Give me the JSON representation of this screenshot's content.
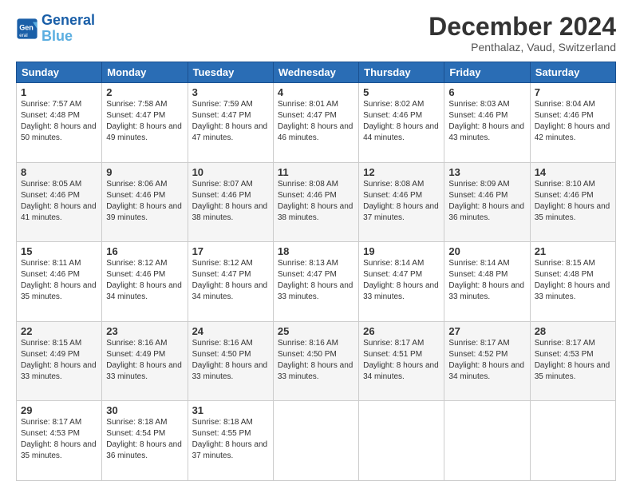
{
  "logo": {
    "line1": "General",
    "line2": "Blue"
  },
  "title": "December 2024",
  "subtitle": "Penthalaz, Vaud, Switzerland",
  "days": [
    "Sunday",
    "Monday",
    "Tuesday",
    "Wednesday",
    "Thursday",
    "Friday",
    "Saturday"
  ],
  "weeks": [
    [
      {
        "day": "1",
        "sunrise": "7:57 AM",
        "sunset": "4:48 PM",
        "daylight": "8 hours and 50 minutes."
      },
      {
        "day": "2",
        "sunrise": "7:58 AM",
        "sunset": "4:47 PM",
        "daylight": "8 hours and 49 minutes."
      },
      {
        "day": "3",
        "sunrise": "7:59 AM",
        "sunset": "4:47 PM",
        "daylight": "8 hours and 47 minutes."
      },
      {
        "day": "4",
        "sunrise": "8:01 AM",
        "sunset": "4:47 PM",
        "daylight": "8 hours and 46 minutes."
      },
      {
        "day": "5",
        "sunrise": "8:02 AM",
        "sunset": "4:46 PM",
        "daylight": "8 hours and 44 minutes."
      },
      {
        "day": "6",
        "sunrise": "8:03 AM",
        "sunset": "4:46 PM",
        "daylight": "8 hours and 43 minutes."
      },
      {
        "day": "7",
        "sunrise": "8:04 AM",
        "sunset": "4:46 PM",
        "daylight": "8 hours and 42 minutes."
      }
    ],
    [
      {
        "day": "8",
        "sunrise": "8:05 AM",
        "sunset": "4:46 PM",
        "daylight": "8 hours and 41 minutes."
      },
      {
        "day": "9",
        "sunrise": "8:06 AM",
        "sunset": "4:46 PM",
        "daylight": "8 hours and 39 minutes."
      },
      {
        "day": "10",
        "sunrise": "8:07 AM",
        "sunset": "4:46 PM",
        "daylight": "8 hours and 38 minutes."
      },
      {
        "day": "11",
        "sunrise": "8:08 AM",
        "sunset": "4:46 PM",
        "daylight": "8 hours and 38 minutes."
      },
      {
        "day": "12",
        "sunrise": "8:08 AM",
        "sunset": "4:46 PM",
        "daylight": "8 hours and 37 minutes."
      },
      {
        "day": "13",
        "sunrise": "8:09 AM",
        "sunset": "4:46 PM",
        "daylight": "8 hours and 36 minutes."
      },
      {
        "day": "14",
        "sunrise": "8:10 AM",
        "sunset": "4:46 PM",
        "daylight": "8 hours and 35 minutes."
      }
    ],
    [
      {
        "day": "15",
        "sunrise": "8:11 AM",
        "sunset": "4:46 PM",
        "daylight": "8 hours and 35 minutes."
      },
      {
        "day": "16",
        "sunrise": "8:12 AM",
        "sunset": "4:46 PM",
        "daylight": "8 hours and 34 minutes."
      },
      {
        "day": "17",
        "sunrise": "8:12 AM",
        "sunset": "4:47 PM",
        "daylight": "8 hours and 34 minutes."
      },
      {
        "day": "18",
        "sunrise": "8:13 AM",
        "sunset": "4:47 PM",
        "daylight": "8 hours and 33 minutes."
      },
      {
        "day": "19",
        "sunrise": "8:14 AM",
        "sunset": "4:47 PM",
        "daylight": "8 hours and 33 minutes."
      },
      {
        "day": "20",
        "sunrise": "8:14 AM",
        "sunset": "4:48 PM",
        "daylight": "8 hours and 33 minutes."
      },
      {
        "day": "21",
        "sunrise": "8:15 AM",
        "sunset": "4:48 PM",
        "daylight": "8 hours and 33 minutes."
      }
    ],
    [
      {
        "day": "22",
        "sunrise": "8:15 AM",
        "sunset": "4:49 PM",
        "daylight": "8 hours and 33 minutes."
      },
      {
        "day": "23",
        "sunrise": "8:16 AM",
        "sunset": "4:49 PM",
        "daylight": "8 hours and 33 minutes."
      },
      {
        "day": "24",
        "sunrise": "8:16 AM",
        "sunset": "4:50 PM",
        "daylight": "8 hours and 33 minutes."
      },
      {
        "day": "25",
        "sunrise": "8:16 AM",
        "sunset": "4:50 PM",
        "daylight": "8 hours and 33 minutes."
      },
      {
        "day": "26",
        "sunrise": "8:17 AM",
        "sunset": "4:51 PM",
        "daylight": "8 hours and 34 minutes."
      },
      {
        "day": "27",
        "sunrise": "8:17 AM",
        "sunset": "4:52 PM",
        "daylight": "8 hours and 34 minutes."
      },
      {
        "day": "28",
        "sunrise": "8:17 AM",
        "sunset": "4:53 PM",
        "daylight": "8 hours and 35 minutes."
      }
    ],
    [
      {
        "day": "29",
        "sunrise": "8:17 AM",
        "sunset": "4:53 PM",
        "daylight": "8 hours and 35 minutes."
      },
      {
        "day": "30",
        "sunrise": "8:18 AM",
        "sunset": "4:54 PM",
        "daylight": "8 hours and 36 minutes."
      },
      {
        "day": "31",
        "sunrise": "8:18 AM",
        "sunset": "4:55 PM",
        "daylight": "8 hours and 37 minutes."
      },
      null,
      null,
      null,
      null
    ]
  ],
  "labels": {
    "sunrise": "Sunrise:",
    "sunset": "Sunset:",
    "daylight": "Daylight:"
  }
}
